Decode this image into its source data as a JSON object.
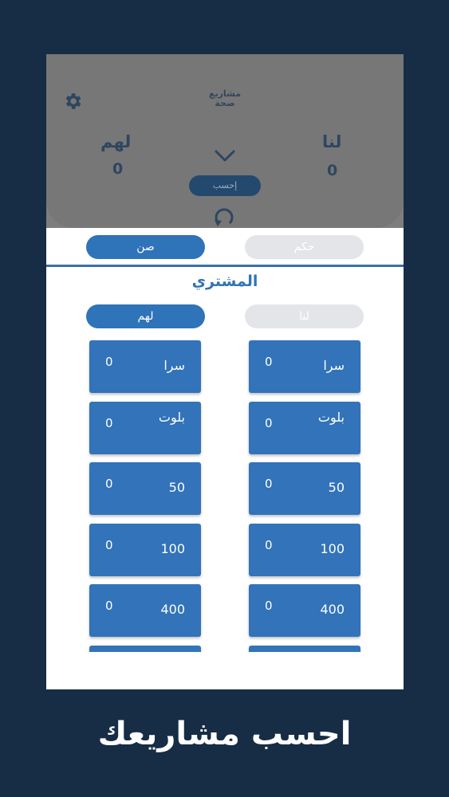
{
  "header": {
    "logo_text": "مشاريع صحة",
    "team_left": {
      "label": "لهم",
      "score": "0"
    },
    "team_right": {
      "label": "لنا",
      "score": "0"
    },
    "calculate_button": "إحسب",
    "gear_icon": "gear-icon",
    "chevron_icon": "chevron-down-icon",
    "undo_icon": "undo-icon"
  },
  "sheet": {
    "mode_tabs": [
      {
        "label": "صن",
        "active": true
      },
      {
        "label": "حكم",
        "active": false
      }
    ],
    "buyer_title": "المشتري",
    "team_tabs": [
      {
        "label": "لهم",
        "active": true
      },
      {
        "label": "لنا",
        "active": false
      }
    ],
    "columns": [
      {
        "team": "لهم",
        "cards": [
          {
            "label": "سرا",
            "value": "0"
          },
          {
            "label": "بلوت",
            "value": "0"
          },
          {
            "label": "50",
            "value": "0"
          },
          {
            "label": "100",
            "value": "0"
          },
          {
            "label": "400",
            "value": "0"
          }
        ]
      },
      {
        "team": "لنا",
        "cards": [
          {
            "label": "سرا",
            "value": "0"
          },
          {
            "label": "بلوت",
            "value": "0"
          },
          {
            "label": "50",
            "value": "0"
          },
          {
            "label": "100",
            "value": "0"
          },
          {
            "label": "400",
            "value": "0"
          }
        ]
      }
    ]
  },
  "caption": "احسب مشاريعك",
  "colors": {
    "background": "#172c45",
    "accent": "#2f73b9",
    "card": "#3273ba",
    "inactive": "#e4e5e8"
  }
}
